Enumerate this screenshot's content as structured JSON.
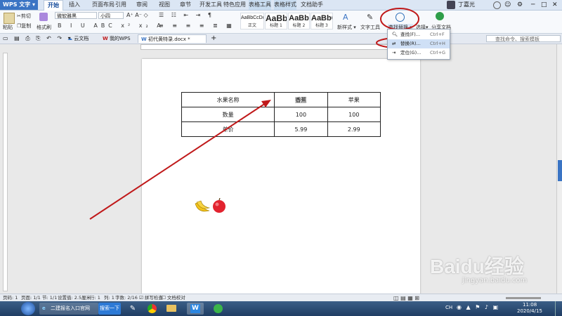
{
  "app": {
    "name": "WPS 文字"
  },
  "menu": [
    "开始",
    "插入",
    "页面布局",
    "引用",
    "审阅",
    "视图",
    "章节",
    "开发工具",
    "特色应用",
    "表格工具",
    "表格样式",
    "文档助手"
  ],
  "user": {
    "name": "丁嘉光"
  },
  "ribbon": {
    "paste": "粘贴",
    "cut": "剪切",
    "copy": "复制",
    "format_painter": "格式刷",
    "font_name": "微软雅黑",
    "font_size": "小四",
    "styles": [
      {
        "preview": "AaBbCcDd",
        "label": "正文"
      },
      {
        "preview": "AaBb",
        "label": "标题 1"
      },
      {
        "preview": "AaBb",
        "label": "标题 2"
      },
      {
        "preview": "AaBbC",
        "label": "标题 3"
      }
    ],
    "new_style": "新样式",
    "text_tools": "文字工具",
    "find_replace": "查找替换",
    "select": "选择",
    "share_doc": "分享文档"
  },
  "tabs": {
    "cloud_doc": "云文档",
    "my_wps": "我的WPS",
    "document": "初代黄特录.docx *",
    "search_placeholder": "查找命令、搜索模板"
  },
  "dropdown": [
    {
      "label": "查找(F)...",
      "shortcut": "Ctrl+F"
    },
    {
      "label": "替换(R)...",
      "shortcut": "Ctrl+H"
    },
    {
      "label": "定位(G)...",
      "shortcut": "Ctrl+G"
    }
  ],
  "table": {
    "rows": [
      [
        "水果名称",
        "香蕉",
        "苹果"
      ],
      [
        "数量",
        "100",
        "100"
      ],
      [
        "单价",
        "5.99",
        "2.99"
      ]
    ]
  },
  "status": {
    "page": "页码: 1",
    "pages": "页面: 1/1",
    "section": "节: 1/1",
    "setting": "设置值: 2.5厘米",
    "row": "行: 1",
    "col": "列: 1",
    "words": "字数: 2/16",
    "spell": "拼写检查",
    "doc_check": "文档校对"
  },
  "taskbar": {
    "ie_window": "二建报名入口官网",
    "search_button": "搜索一下",
    "ime": "CH",
    "time": "11:08",
    "date": "2020/4/15"
  },
  "watermark": {
    "brand": "Baidu经验",
    "url": "jingyan.baidu.com"
  },
  "colors": {
    "accent": "#3a74c4",
    "annotation": "#c0191a",
    "ribbon": "#f7f9fc"
  }
}
